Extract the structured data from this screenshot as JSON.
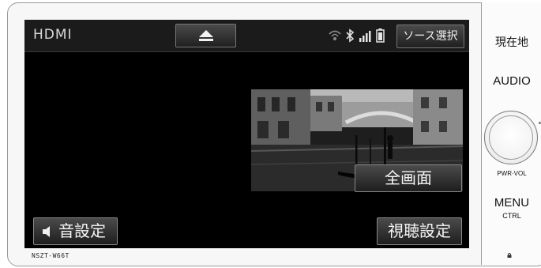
{
  "screen": {
    "source_label": "HDMI",
    "source_select_label": "ソース選択",
    "fullscreen_label": "全画面",
    "sound_settings_label": "音設定",
    "view_settings_label": "視聴設定"
  },
  "status_icons": [
    "wifi-icon",
    "bluetooth-icon",
    "signal-icon",
    "battery-icon"
  ],
  "model_label": "NSZT-W66T",
  "hardkeys": {
    "current_location": "現在地",
    "audio": "AUDIO",
    "pwr_vol": "PWR·VOL",
    "menu": "MENU",
    "ctrl": "CTRL"
  }
}
